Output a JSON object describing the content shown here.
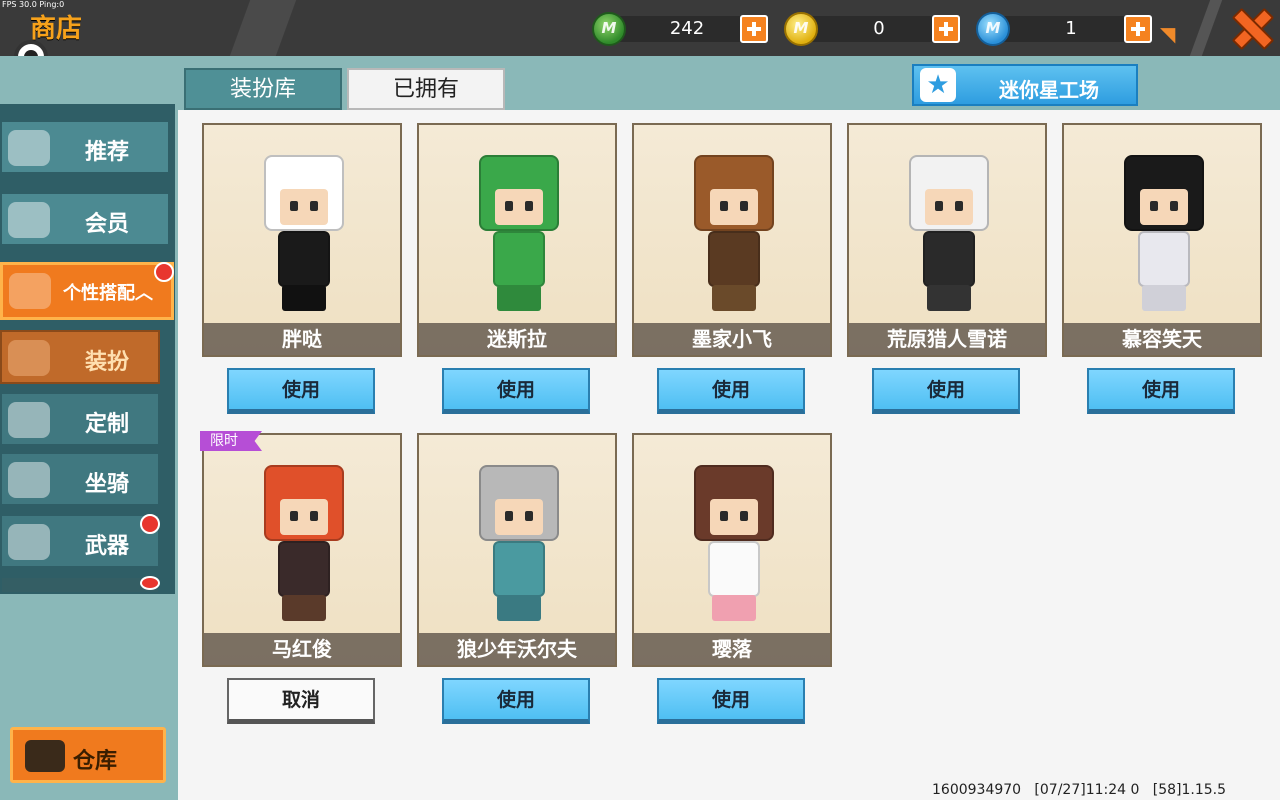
{
  "fps": "FPS 30.0  Ping:0",
  "header": {
    "title": "商店",
    "currencies": [
      {
        "name": "green-gem",
        "value": "242",
        "color": "#3aa12e"
      },
      {
        "name": "gold-coin",
        "value": "0",
        "color": "#e0b010"
      },
      {
        "name": "blue-coin",
        "value": "1",
        "color": "#2a8fd8"
      }
    ],
    "coin_letter": "M"
  },
  "sidebar": {
    "items": [
      {
        "label": "推荐",
        "icon": "thumbs-up-icon"
      },
      {
        "label": "会员",
        "icon": "vip-icon"
      },
      {
        "label": "个性搭配",
        "icon": "trophy-icon",
        "suffix": "︿"
      },
      {
        "label": "装扮",
        "icon": "shirt-icon"
      },
      {
        "label": "定制",
        "icon": "pencil-icon"
      },
      {
        "label": "坐骑",
        "icon": "saddle-icon"
      },
      {
        "label": "武器",
        "icon": "gun-icon"
      }
    ],
    "warehouse_label": "仓库"
  },
  "tabs": [
    {
      "label": "装扮库",
      "selected": true
    },
    {
      "label": "已拥有",
      "selected": false
    }
  ],
  "workshop_label": "迷你星工场",
  "cards": [
    {
      "name": "胖哒",
      "button": "使用",
      "head": "#ffffff",
      "body": "#1a1a1a",
      "legs": "#111111",
      "face_tone": "#f6d7b8"
    },
    {
      "name": "迷斯拉",
      "button": "使用",
      "head": "#3aa84a",
      "body": "#3aa84a",
      "legs": "#2f8a3c",
      "face_tone": "#f6d7b8"
    },
    {
      "name": "墨家小飞",
      "button": "使用",
      "head": "#9a5a2a",
      "body": "#5a3a22",
      "legs": "#6a4a2a",
      "face_tone": "#f6d7b8"
    },
    {
      "name": "荒原猎人雪诺",
      "button": "使用",
      "head": "#f2f2f2",
      "body": "#2a2a2a",
      "legs": "#333333",
      "face_tone": "#f6d7b8"
    },
    {
      "name": "慕容笑天",
      "button": "使用",
      "head": "#1a1a1a",
      "body": "#e8e8ee",
      "legs": "#d0d0d8",
      "face_tone": "#f6d7b8"
    },
    {
      "name": "马红俊",
      "button": "取消",
      "head": "#e0502a",
      "body": "#3a2a2a",
      "legs": "#5a3a2a",
      "face_tone": "#f6d7b8",
      "tag": "限时"
    },
    {
      "name": "狼少年沃尔夫",
      "button": "使用",
      "head": "#b8b8b8",
      "body": "#4a9aa0",
      "legs": "#3a7a82",
      "face_tone": "#f6d7b8"
    },
    {
      "name": "璎落",
      "button": "使用",
      "head": "#6a3a2a",
      "body": "#fafafa",
      "legs": "#f0a0b0",
      "face_tone": "#f6d7b8"
    }
  ],
  "status_bar": "1600934970   [07/27]11:24 0   [58]1.15.5"
}
